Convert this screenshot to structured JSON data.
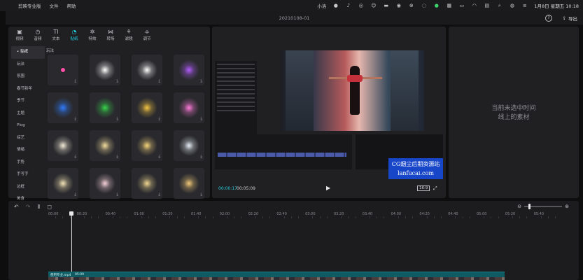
{
  "menubar": {
    "app_name": "剪映专业版",
    "menus": [
      "文件",
      "帮助"
    ],
    "tray_text": "小洛",
    "clock": "1月8日 星期五 10:18"
  },
  "window": {
    "title": "20210108-01",
    "export_label": "导出"
  },
  "tool_tabs": [
    {
      "label": "视频",
      "icon": "video-icon"
    },
    {
      "label": "音频",
      "icon": "audio-icon"
    },
    {
      "label": "文本",
      "icon": "text-icon"
    },
    {
      "label": "贴纸",
      "icon": "sticker-icon",
      "active": true
    },
    {
      "label": "特效",
      "icon": "effects-icon"
    },
    {
      "label": "转场",
      "icon": "transition-icon"
    },
    {
      "label": "滤镜",
      "icon": "filter-icon"
    },
    {
      "label": "调节",
      "icon": "adjust-icon"
    }
  ],
  "categories": [
    "贴纸",
    "玩法",
    "氛围",
    "春节新年",
    "季节",
    "主题",
    "Plog",
    "综艺",
    "情绪",
    "手势",
    "手写字",
    "边框",
    "美食"
  ],
  "active_category": "贴纸",
  "subcategory_label": "玩法",
  "stickers": [
    {
      "name": "heart",
      "color": "#ff4fa8"
    },
    {
      "name": "sparkle-white",
      "color": "#ffffff"
    },
    {
      "name": "hearts-white",
      "color": "#ffffff"
    },
    {
      "name": "hearts-purple",
      "color": "#b35cff"
    },
    {
      "name": "hearts-blue",
      "color": "#2f7cff"
    },
    {
      "name": "hearts-green",
      "color": "#36d44a"
    },
    {
      "name": "hearts-gold",
      "color": "#f5c542"
    },
    {
      "name": "hearts-pink",
      "color": "#ff7ad9"
    },
    {
      "name": "burst-white",
      "color": "#f2e9d8"
    },
    {
      "name": "burst-gold",
      "color": "#f2dd9c"
    },
    {
      "name": "burst-gold-2",
      "color": "#f5d47a"
    },
    {
      "name": "burst-silver",
      "color": "#e6eef5"
    },
    {
      "name": "burst-warm",
      "color": "#f3e3b5"
    },
    {
      "name": "burst-pink",
      "color": "#f5cfd8"
    },
    {
      "name": "burst-gold-3",
      "color": "#f0d890"
    },
    {
      "name": "burst-amber",
      "color": "#f0c878"
    }
  ],
  "player": {
    "current_time": "00:00:17",
    "total_time": "00:05:09",
    "ratio": "16:9",
    "watermark_line1": "CG烟尘后期资源站",
    "watermark_line2": "lanfucai.com"
  },
  "props": {
    "empty_line1": "当前未选中时间",
    "empty_line2": "线上的素材"
  },
  "timeline": {
    "ticks": [
      "00:00",
      "00:20",
      "00:40",
      "01:00",
      "01:20",
      "01:40",
      "02:00",
      "02:20",
      "02:40",
      "03:00",
      "03:20",
      "03:40",
      "04:00",
      "04:20",
      "04:40",
      "05:00",
      "05:20",
      "05:40"
    ],
    "clip_name": "使用专业.mp4",
    "clip_duration": "05:09"
  }
}
